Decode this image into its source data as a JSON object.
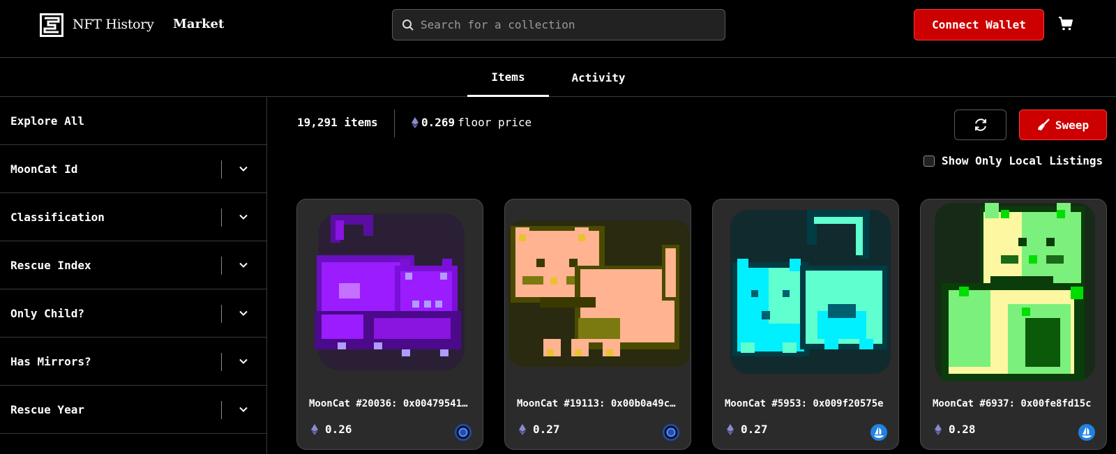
{
  "header": {
    "brand": "NFT History",
    "nav_market": "Market",
    "search_placeholder": "Search for a collection",
    "connect_label": "Connect Wallet"
  },
  "tabs": [
    {
      "label": "Items",
      "active": true
    },
    {
      "label": "Activity",
      "active": false
    }
  ],
  "sidebar": {
    "explore": "Explore All",
    "filters": [
      "MoonCat Id",
      "Classification",
      "Rescue Index",
      "Only Child?",
      "Has Mirrors?",
      "Rescue Year"
    ]
  },
  "stats": {
    "items_count": "19,291 items",
    "floor_value": "0.269",
    "floor_label": "floor price"
  },
  "actions": {
    "sweep_label": "Sweep",
    "local_listings_label": "Show Only Local Listings",
    "local_listings_checked": false
  },
  "cards": [
    {
      "title": "MoonCat #20036: 0x00479541…",
      "price": "0.26",
      "marketplace_icon": "ring-marketplace-icon"
    },
    {
      "title": "MoonCat #19113: 0x00b0a49c…",
      "price": "0.27",
      "marketplace_icon": "ring-marketplace-icon"
    },
    {
      "title": "MoonCat #5953: 0x009f20575e",
      "price": "0.27",
      "marketplace_icon": "opensea-icon"
    },
    {
      "title": "MoonCat #6937: 0x00fe8fd15c",
      "price": "0.28",
      "marketplace_icon": "opensea-icon"
    }
  ],
  "colors": {
    "accent": "#cc0000",
    "background": "#000000",
    "card": "#2b2b2b",
    "cat_purple": "#9b1cff",
    "cat_peach": "#ffb391",
    "cat_cyan": "#00f0ff",
    "cat_green": "#7cf07c"
  }
}
